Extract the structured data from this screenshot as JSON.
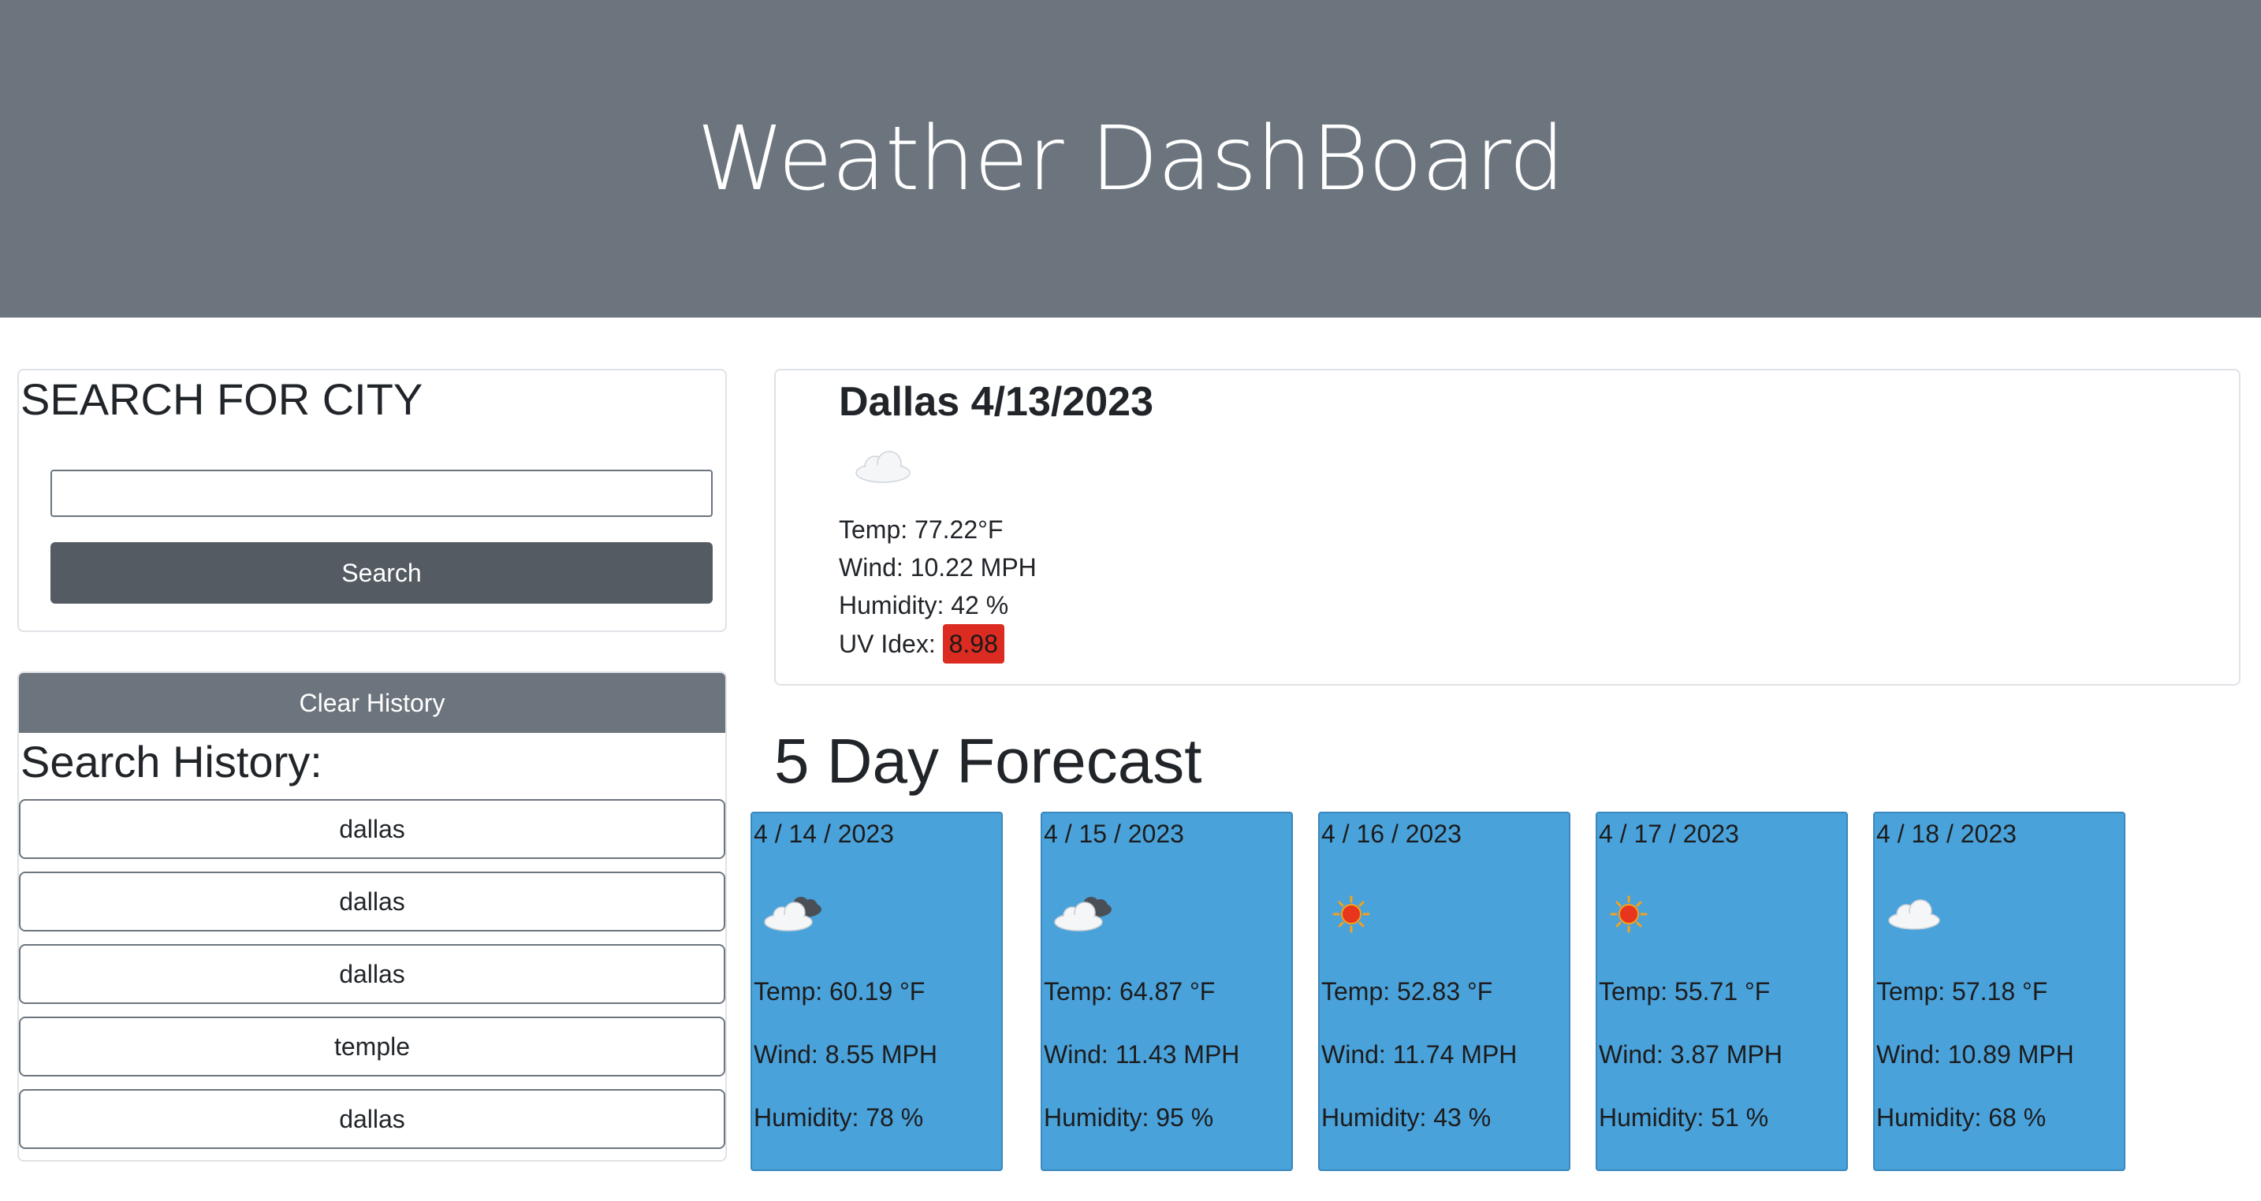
{
  "header": {
    "title": "Weather DashBoard"
  },
  "search": {
    "heading": "SEARCH FOR CITY",
    "input_value": "",
    "button_label": "Search"
  },
  "history": {
    "clear_label": "Clear History",
    "heading": "Search History:",
    "items": [
      "dallas",
      "dallas",
      "dallas",
      "temple",
      "dallas"
    ]
  },
  "current": {
    "title": "Dallas 4/13/2023",
    "icon": "cloud-icon",
    "temp": "Temp: 77.22°F",
    "wind": "Wind: 10.22 MPH",
    "humidity": "Humidity: 42 %",
    "uv_label": "UV Idex:",
    "uv_value": "8.98",
    "uv_color": "#dc2b20"
  },
  "forecast": {
    "heading": "5 Day Forecast",
    "card_color": "#4aa2db",
    "days": [
      {
        "date": "4 / 14 / 2023",
        "icon": "partly-cloudy-icon",
        "temp": "Temp: 60.19 °F",
        "wind": "Wind: 8.55 MPH",
        "humidity": "Humidity: 78 %"
      },
      {
        "date": "4 / 15 / 2023",
        "icon": "partly-cloudy-icon",
        "temp": "Temp: 64.87 °F",
        "wind": "Wind: 11.43 MPH",
        "humidity": "Humidity: 95 %"
      },
      {
        "date": "4 / 16 / 2023",
        "icon": "sun-icon",
        "temp": "Temp: 52.83 °F",
        "wind": "Wind: 11.74 MPH",
        "humidity": "Humidity: 43 %"
      },
      {
        "date": "4 / 17 / 2023",
        "icon": "sun-icon",
        "temp": "Temp: 55.71 °F",
        "wind": "Wind: 3.87 MPH",
        "humidity": "Humidity: 51 %"
      },
      {
        "date": "4 / 18 / 2023",
        "icon": "cloud-icon",
        "temp": "Temp: 57.18 °F",
        "wind": "Wind: 10.89 MPH",
        "humidity": "Humidity: 68 %"
      }
    ]
  }
}
